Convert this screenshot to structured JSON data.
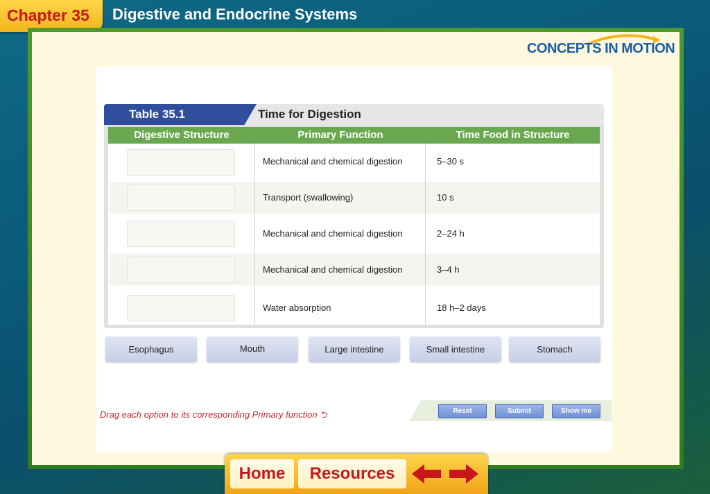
{
  "header": {
    "chapter": "Chapter 35",
    "title": "Digestive and Endocrine Systems"
  },
  "logo": {
    "text": "CONCEPTS IN MOTION"
  },
  "table": {
    "number": "Table 35.1",
    "title": "Time for Digestion",
    "columns": [
      "Digestive Structure",
      "Primary Function",
      "Time Food in Structure"
    ],
    "rows": [
      {
        "function": "Mechanical and chemical digestion",
        "time": "5–30 s"
      },
      {
        "function": "Transport (swallowing)",
        "time": "10 s"
      },
      {
        "function": "Mechanical and chemical digestion",
        "time": "2–24 h"
      },
      {
        "function": "Mechanical and chemical digestion",
        "time": "3–4 h"
      },
      {
        "function": "Water absorption",
        "time": "18 h–2 days"
      }
    ]
  },
  "options": [
    "Esophagus",
    "Mouth",
    "Large intestine",
    "Small intestine",
    "Stomach"
  ],
  "footer": {
    "instruction": "Drag each option to its corresponding Primary function",
    "reset": "Reset",
    "submit": "Submit",
    "show_me": "Show me"
  },
  "nav": {
    "home": "Home",
    "resources": "Resources"
  },
  "colors": {
    "accent": "#c8171c",
    "table_header": "#6aa84f",
    "table_tab": "#2f4f9e"
  }
}
